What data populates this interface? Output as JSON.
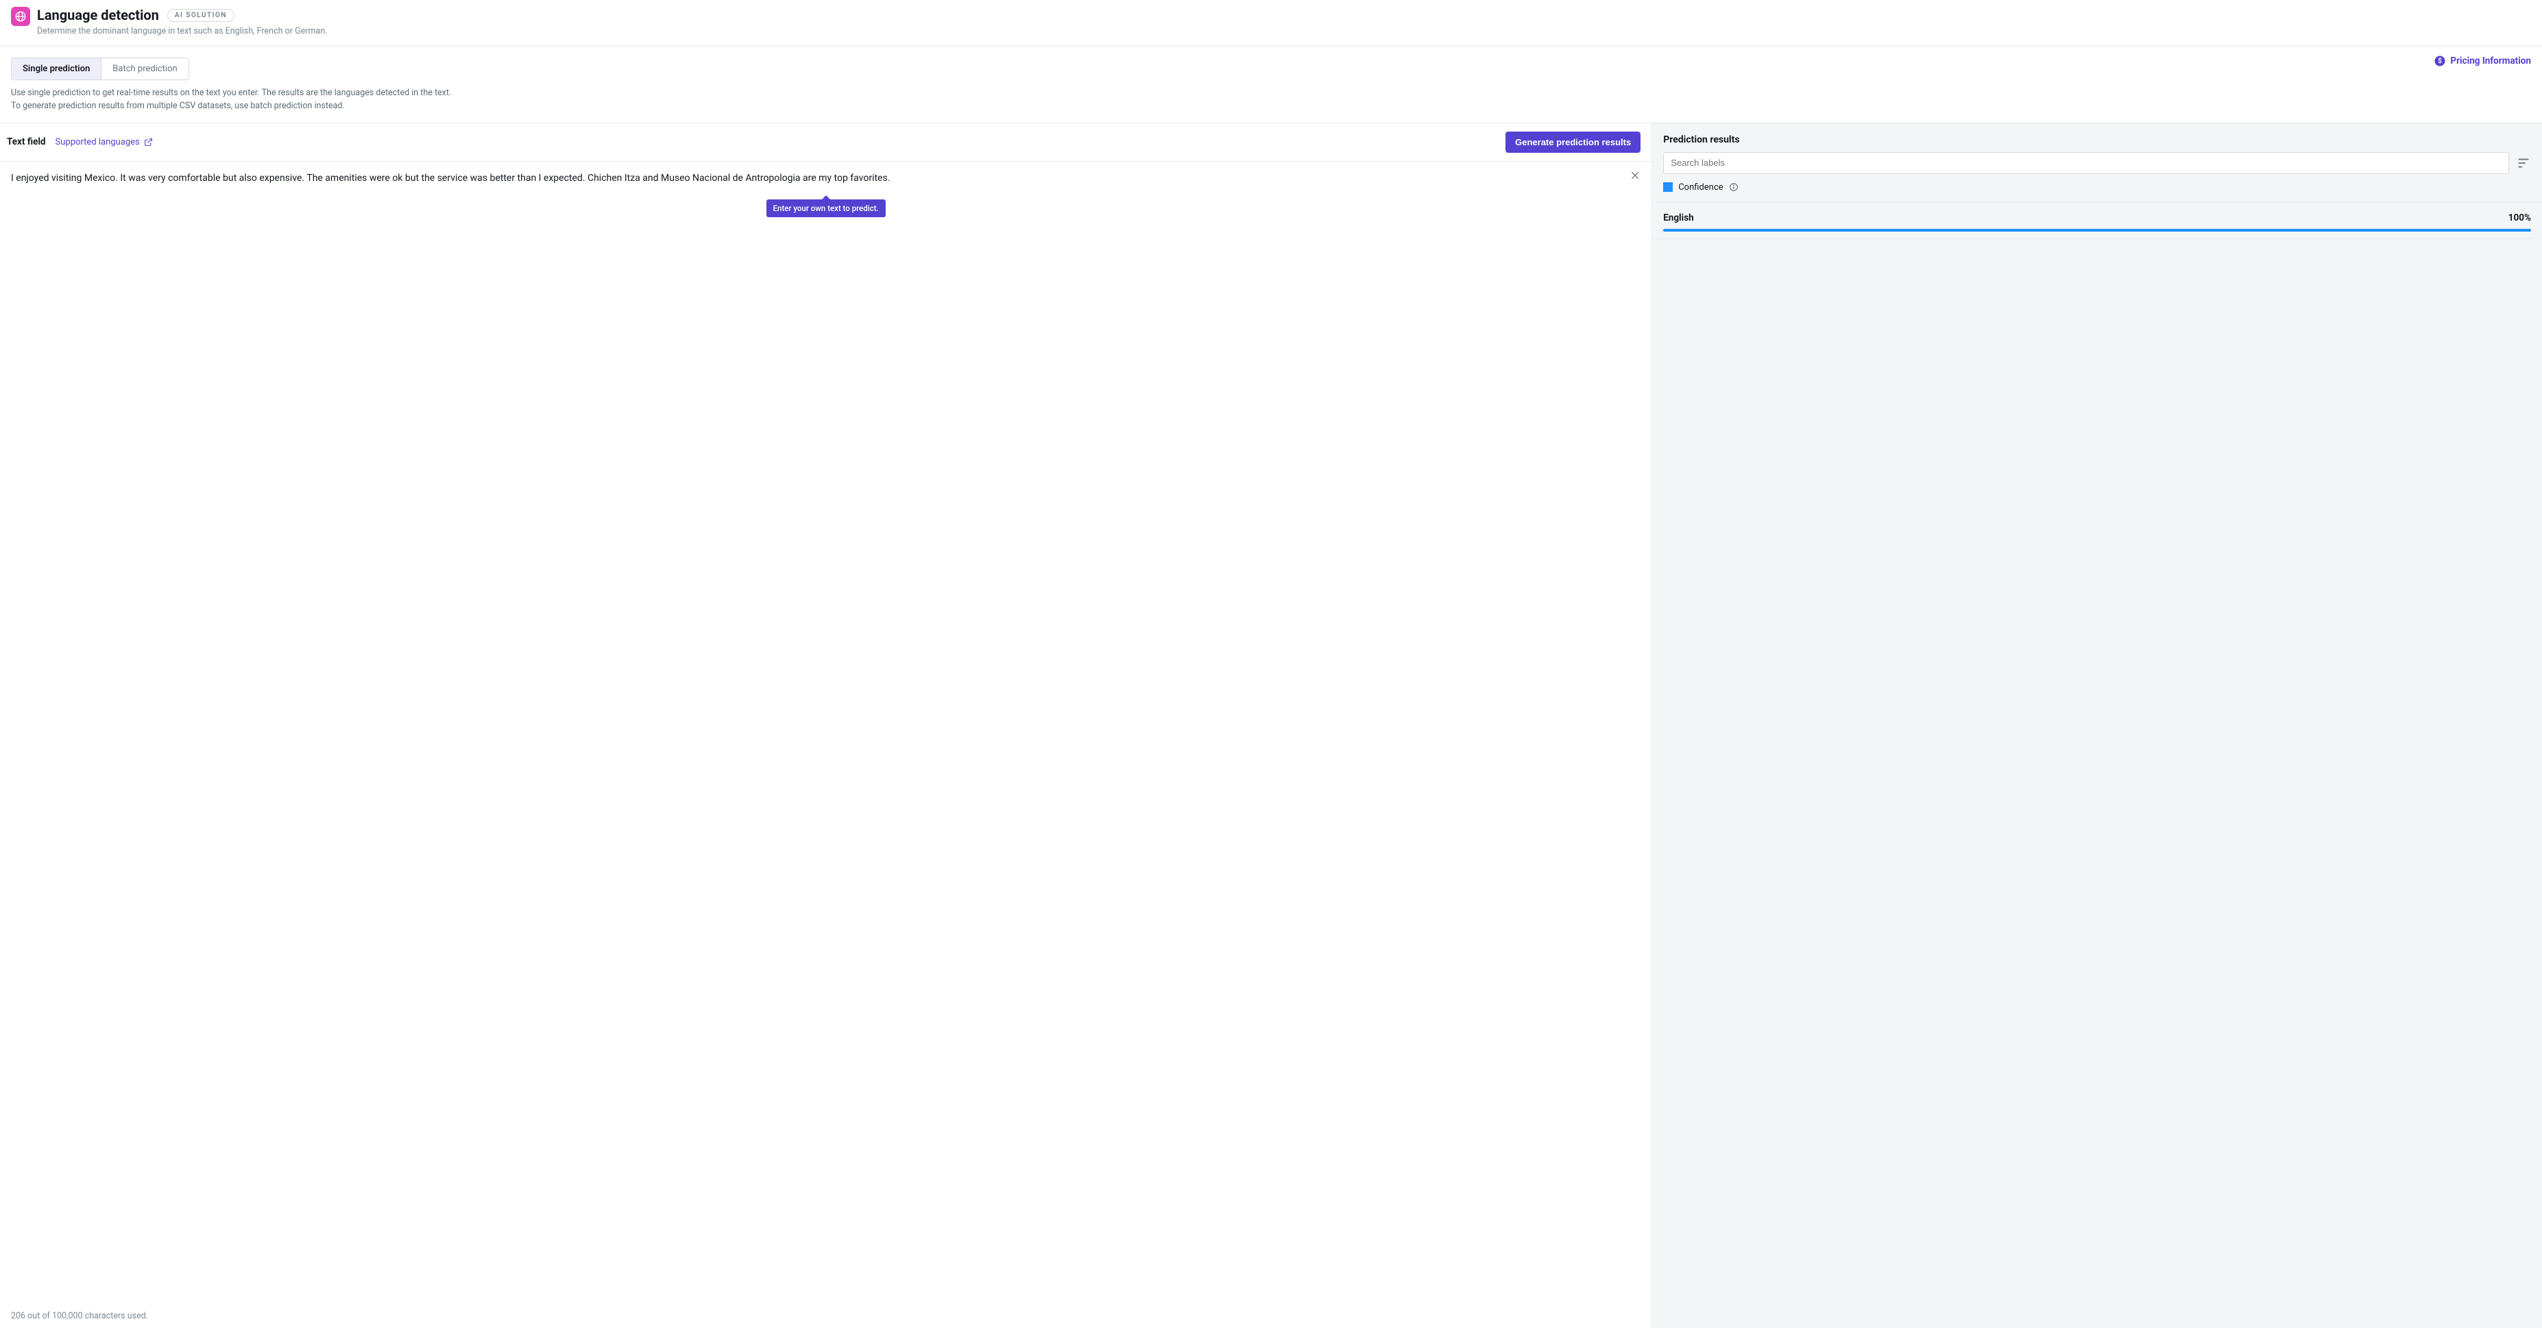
{
  "header": {
    "title": "Language detection",
    "badge": "AI SOLUTION",
    "subtitle": "Determine the dominant language in text such as English, French or German."
  },
  "tabs": {
    "single": "Single prediction",
    "batch": "Batch prediction",
    "desc_line1": "Use single prediction to get real-time results on the text you enter. The results are the languages detected in the text.",
    "desc_line2": "To generate prediction results from multiple CSV datasets, use batch prediction instead."
  },
  "pricing_label": "Pricing Information",
  "text_field": {
    "label": "Text field",
    "supported_languages": "Supported languages",
    "generate_button": "Generate prediction results",
    "value": "I enjoyed visiting Mexico. It was very comfortable but also expensive. The amenities were ok but the service was better than I expected. Chichen Itza and Museo Nacional de Antropologia are my top favorites.",
    "tooltip": "Enter your own text to predict.",
    "char_count": "206 out of 100,000 characters used."
  },
  "results": {
    "header": "Prediction results",
    "search_placeholder": "Search labels",
    "confidence_label": "Confidence",
    "rows": [
      {
        "label": "English",
        "value": "100%"
      }
    ]
  }
}
